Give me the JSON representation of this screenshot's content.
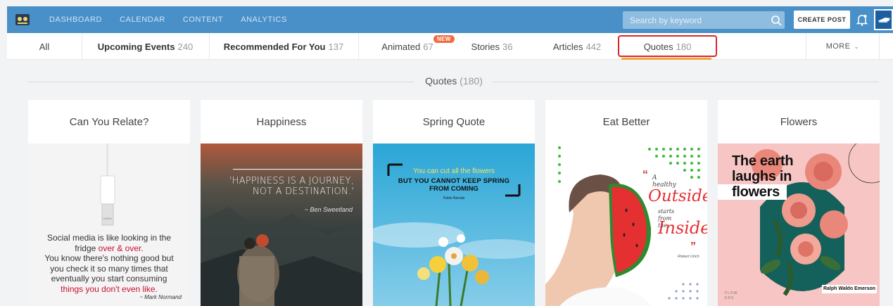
{
  "nav": {
    "items": [
      "DASHBOARD",
      "CALENDAR",
      "CONTENT",
      "ANALYTICS"
    ],
    "search_placeholder": "Search by keyword",
    "create_label": "CREATE POST"
  },
  "tabs": {
    "all": "All",
    "items": [
      {
        "label": "Upcoming Events",
        "count": "240"
      },
      {
        "label": "Recommended For You",
        "count": "137"
      },
      {
        "label": "Animated",
        "count": "67"
      },
      {
        "label": "Stories",
        "count": "36"
      },
      {
        "label": "Articles",
        "count": "442"
      },
      {
        "label": "Quotes",
        "count": "180"
      }
    ],
    "new_badge": "NEW",
    "more": "MORE"
  },
  "section": {
    "title": "Quotes",
    "count": "(180)"
  },
  "cards": [
    {
      "title": "Can You Relate?",
      "quote_lines": [
        "Social media is like looking in the",
        "fridge ",
        "over & over.",
        "You know there's nothing good but",
        "you check it so many times that",
        "eventually you start consuming",
        "things you don't even like."
      ],
      "author": "~ Mark Normand",
      "plug_text": "IIIIIIIII"
    },
    {
      "title": "Happiness",
      "quote_line1": "'HAPPINESS IS A JOURNEY,",
      "quote_line2": "NOT A DESTINATION.'",
      "author": "~ Ben Sweetland"
    },
    {
      "title": "Spring Quote",
      "line1": "You can cut all the flowers",
      "line2": "BUT YOU CANNOT KEEP SPRING",
      "line3": "FROM COMING",
      "author": "Pablo Neruda"
    },
    {
      "title": "Eat Better",
      "w1": "A",
      "w2": "healthy",
      "w3": "Outside",
      "w4": "starts",
      "w5": "from",
      "w6": "the",
      "w7": "Inside",
      "author": "Robert Urich"
    },
    {
      "title": "Flowers",
      "line1": "The earth",
      "line2": "laughs in",
      "line3": "flowers",
      "author": "Ralph Waldo Emerson",
      "corner": "FLOW ERS"
    }
  ],
  "colors": {
    "topbar": "#4a90c8",
    "highlight": "#d9262c",
    "underline": "#f3a73b",
    "badge": "#f26a3d"
  }
}
